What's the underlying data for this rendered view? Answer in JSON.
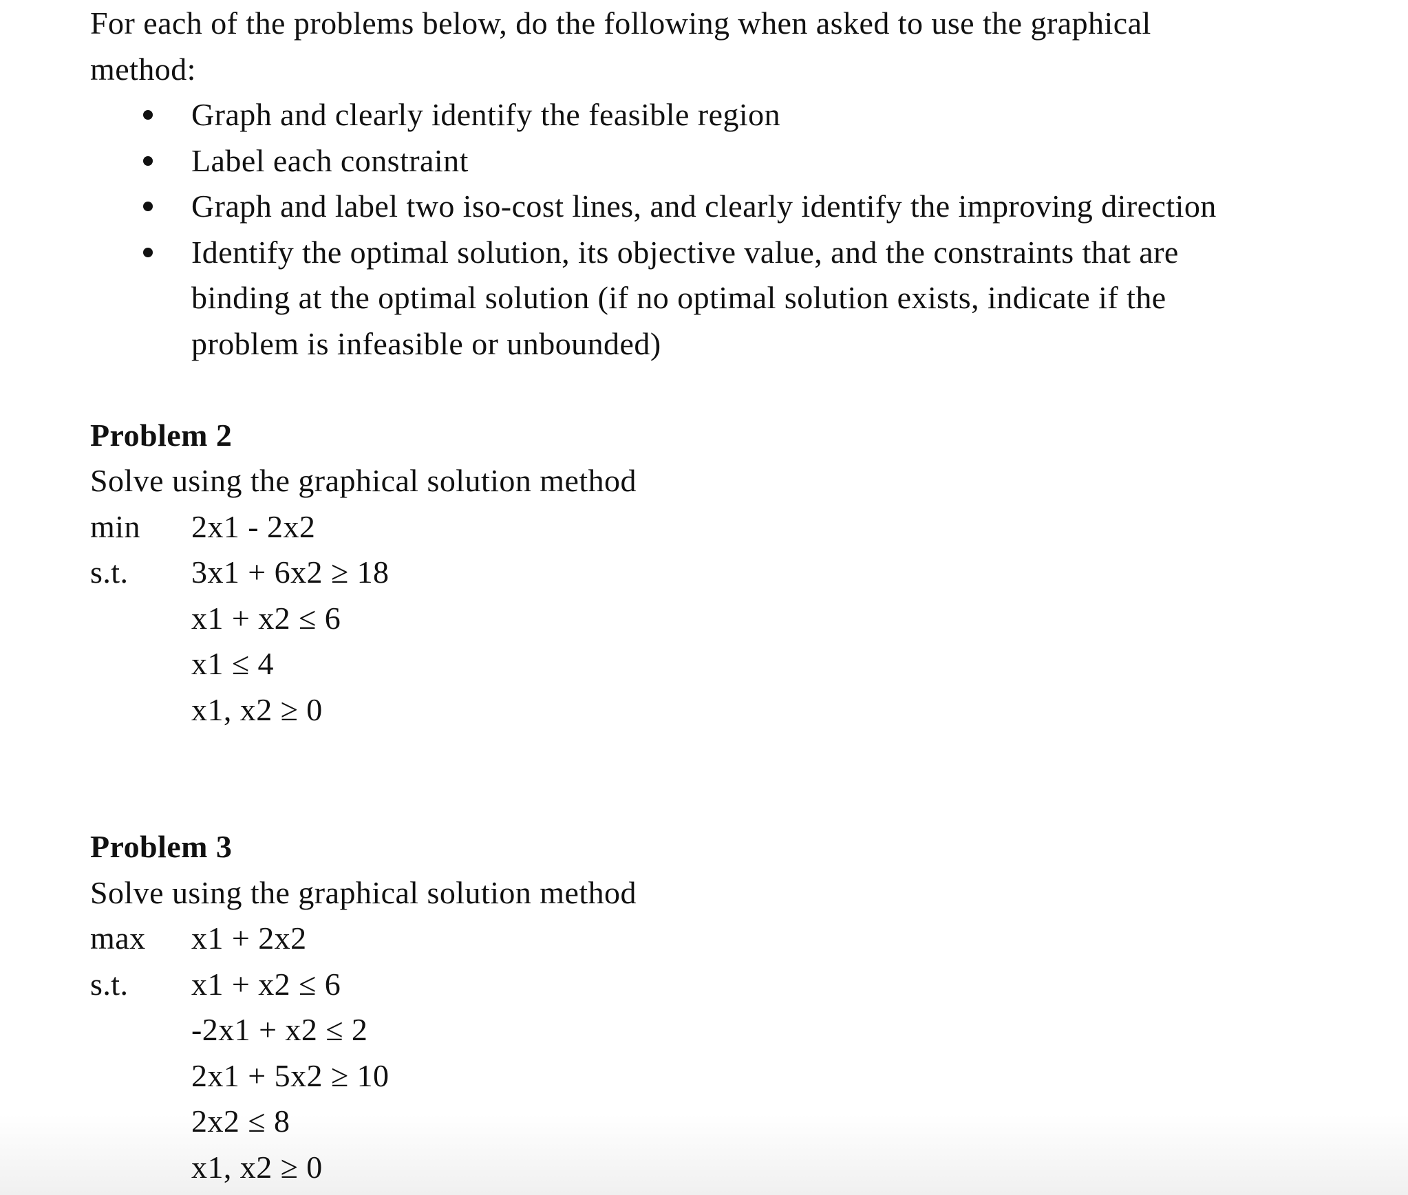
{
  "intro": {
    "line1": "For each of the problems below, do the following when asked to use the graphical",
    "line2": "method:",
    "bullets": [
      "Graph and clearly identify the feasible region",
      "Label each constraint",
      "Graph and label two iso-cost lines, and clearly identify the improving direction",
      "Identify the optimal solution, its objective value, and the constraints that are"
    ],
    "bullet4_cont": [
      "binding at the optimal solution (if no optimal solution exists, indicate if the",
      "problem is infeasible or unbounded)"
    ]
  },
  "problems": [
    {
      "title": "Problem 2",
      "instruction": "Solve using the graphical solution method",
      "objective_keyword": "min",
      "objective": "2x1 - 2x2",
      "st_keyword": "s.t.",
      "constraints": [
        "3x1 + 6x2 ≥ 18",
        "x1 + x2 ≤ 6",
        "x1 ≤ 4",
        "x1, x2 ≥ 0"
      ]
    },
    {
      "title": "Problem 3",
      "instruction": "Solve using the graphical solution method",
      "objective_keyword": "max",
      "objective": "x1 + 2x2",
      "st_keyword": "s.t.",
      "constraints": [
        "x1 + x2 ≤ 6",
        "-2x1 + x2 ≤ 2",
        "2x1 + 5x2 ≥ 10",
        "2x2 ≤ 8",
        "x1, x2 ≥ 0"
      ]
    }
  ]
}
